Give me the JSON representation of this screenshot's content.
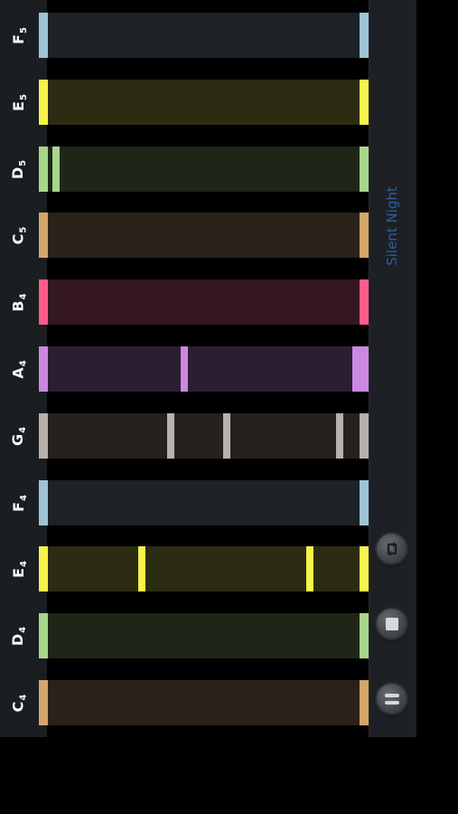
{
  "song": {
    "title": "Silent Night"
  },
  "notes": [
    {
      "name": "F",
      "octave": "5",
      "color": "#9ec3d6",
      "lane_bg": "#1c2226",
      "marks": []
    },
    {
      "name": "E",
      "octave": "5",
      "color": "#f7f34a",
      "lane_bg": "#2b2c12",
      "marks": []
    },
    {
      "name": "D",
      "octave": "5",
      "color": "#a8d68a",
      "lane_bg": "#1f2617",
      "marks": [
        0.04
      ]
    },
    {
      "name": "C",
      "octave": "5",
      "color": "#d4a66a",
      "lane_bg": "#2a2218",
      "marks": []
    },
    {
      "name": "B",
      "octave": "4",
      "color": "#ff5c8a",
      "lane_bg": "#351720",
      "marks": []
    },
    {
      "name": "A",
      "octave": "4",
      "color": "#cc88e0",
      "lane_bg": "#2b1e33",
      "marks": [
        0.43,
        0.95
      ]
    },
    {
      "name": "G",
      "octave": "4",
      "color": "#b8b0aa",
      "lane_bg": "#25211e",
      "marks": [
        0.39,
        0.56,
        0.9
      ]
    },
    {
      "name": "F",
      "octave": "4",
      "color": "#9ec3d6",
      "lane_bg": "#1c2226",
      "marks": []
    },
    {
      "name": "E",
      "octave": "4",
      "color": "#f7f34a",
      "lane_bg": "#2b2c12",
      "marks": [
        0.3,
        0.81
      ]
    },
    {
      "name": "D",
      "octave": "4",
      "color": "#a8d68a",
      "lane_bg": "#1f2617",
      "marks": []
    },
    {
      "name": "C",
      "octave": "4",
      "color": "#d4a66a",
      "lane_bg": "#2a2218",
      "marks": []
    }
  ],
  "controls": {
    "loop": {
      "icon": "loop-icon"
    },
    "stop": {
      "icon": "stop-icon"
    },
    "pause": {
      "icon": "pause-icon"
    }
  }
}
